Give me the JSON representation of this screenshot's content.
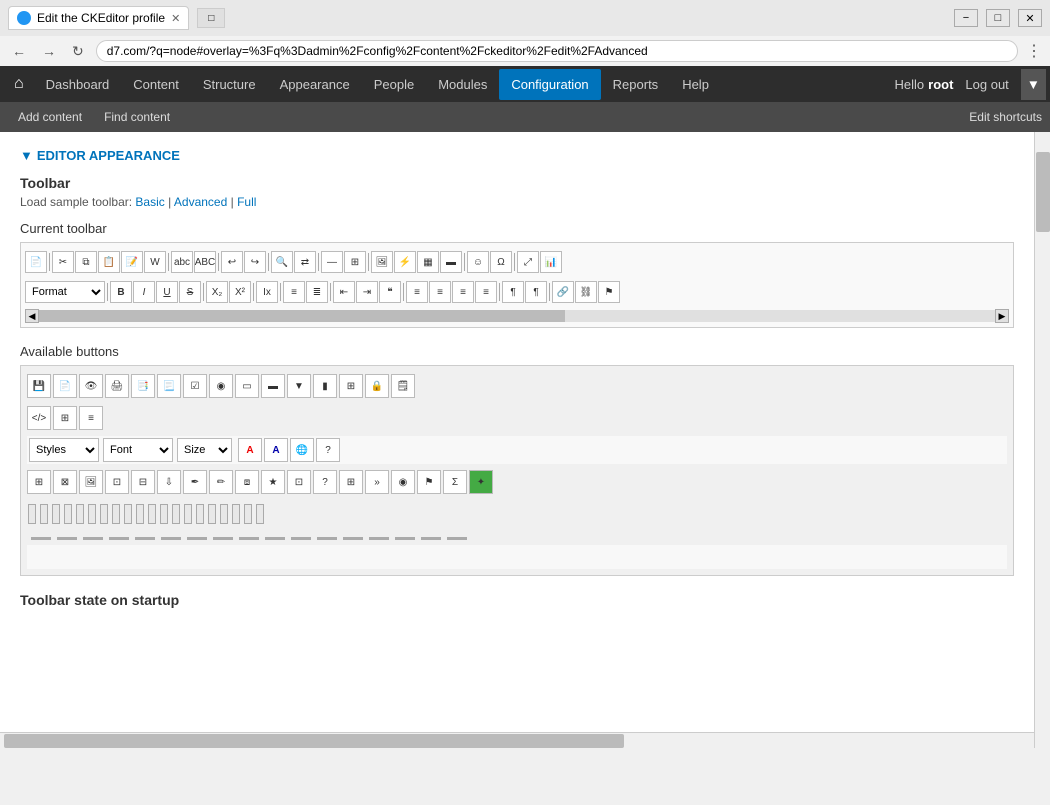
{
  "browser": {
    "tab_title": "Edit the CKEditor profile",
    "url": "d7.com/?q=node#overlay=%3Fq%3Dadmin%2Fconfig%2Fcontent%2Fckeditor%2Fedit%2FAdvanced",
    "back_btn": "←",
    "forward_btn": "→",
    "refresh_btn": "↻"
  },
  "window_controls": {
    "minimize": "−",
    "maximize": "□",
    "close": "✕"
  },
  "nav": {
    "home_icon": "⌂",
    "items": [
      "Dashboard",
      "Content",
      "Structure",
      "Appearance",
      "People",
      "Modules",
      "Configuration",
      "Reports",
      "Help"
    ],
    "active": "Configuration",
    "hello": "Hello",
    "username": "root",
    "logout": "Log out"
  },
  "secondary_nav": {
    "items": [
      "Add content",
      "Find content"
    ],
    "right": "Edit shortcuts"
  },
  "section": {
    "title": "EDITOR APPEARANCE",
    "toolbar_title": "Toolbar",
    "load_sample": "Load sample toolbar:",
    "sample_basic": "Basic",
    "sample_advanced": "Advanced",
    "sample_full": "Full",
    "current_toolbar_label": "Current toolbar",
    "available_buttons_label": "Available buttons",
    "format_label": "Format",
    "styles_label": "Styles",
    "font_label": "Font",
    "size_label": "Size",
    "toolbar_state_label": "Toolbar state on startup"
  }
}
